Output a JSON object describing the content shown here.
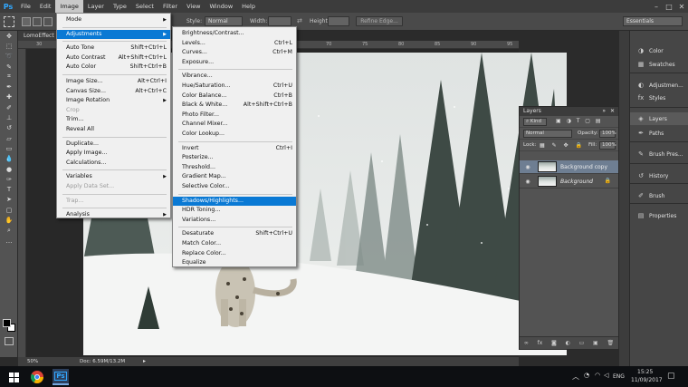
{
  "app": {
    "logo": "Ps"
  },
  "menubar": {
    "items": [
      "File",
      "Edit",
      "Image",
      "Layer",
      "Type",
      "Select",
      "Filter",
      "View",
      "Window",
      "Help"
    ],
    "active_index": 2,
    "window_controls": {
      "minimize": "–",
      "maximize": "□",
      "close": "✕"
    }
  },
  "options_bar": {
    "style_label": "Style:",
    "style_value": "Normal",
    "width_label": "Width:",
    "height_label": "Height:",
    "refine_edge": "Refine Edge...",
    "workspace": "Essentials"
  },
  "document": {
    "tab_label": "LomoEffect",
    "zoom": "50%",
    "doc_info": "Doc: 6.59M/13.2M",
    "ruler_numbers": [
      "30",
      "35",
      "40",
      "45",
      "50",
      "55",
      "60",
      "65",
      "70",
      "75",
      "80",
      "85",
      "90",
      "95"
    ]
  },
  "image_menu": {
    "items": [
      {
        "label": "Mode",
        "shortcut": "",
        "submenu": true,
        "disabled": false
      },
      {
        "sep": true
      },
      {
        "label": "Adjustments",
        "shortcut": "",
        "submenu": true,
        "disabled": false,
        "highlight": true
      },
      {
        "sep": true
      },
      {
        "label": "Auto Tone",
        "shortcut": "Shift+Ctrl+L",
        "disabled": false
      },
      {
        "label": "Auto Contrast",
        "shortcut": "Alt+Shift+Ctrl+L",
        "disabled": false
      },
      {
        "label": "Auto Color",
        "shortcut": "Shift+Ctrl+B",
        "disabled": false
      },
      {
        "sep": true
      },
      {
        "label": "Image Size...",
        "shortcut": "Alt+Ctrl+I",
        "disabled": false
      },
      {
        "label": "Canvas Size...",
        "shortcut": "Alt+Ctrl+C",
        "disabled": false
      },
      {
        "label": "Image Rotation",
        "shortcut": "",
        "submenu": true,
        "disabled": false
      },
      {
        "label": "Crop",
        "shortcut": "",
        "disabled": true
      },
      {
        "label": "Trim...",
        "shortcut": "",
        "disabled": false
      },
      {
        "label": "Reveal All",
        "shortcut": "",
        "disabled": false
      },
      {
        "sep": true
      },
      {
        "label": "Duplicate...",
        "shortcut": "",
        "disabled": false
      },
      {
        "label": "Apply Image...",
        "shortcut": "",
        "disabled": false
      },
      {
        "label": "Calculations...",
        "shortcut": "",
        "disabled": false
      },
      {
        "sep": true
      },
      {
        "label": "Variables",
        "shortcut": "",
        "submenu": true,
        "disabled": false
      },
      {
        "label": "Apply Data Set...",
        "shortcut": "",
        "disabled": true
      },
      {
        "sep": true
      },
      {
        "label": "Trap...",
        "shortcut": "",
        "disabled": true
      },
      {
        "sep": true
      },
      {
        "label": "Analysis",
        "shortcut": "",
        "submenu": true,
        "disabled": false
      }
    ]
  },
  "adjustments_menu": {
    "items": [
      {
        "label": "Brightness/Contrast...",
        "shortcut": ""
      },
      {
        "label": "Levels...",
        "shortcut": "Ctrl+L"
      },
      {
        "label": "Curves...",
        "shortcut": "Ctrl+M"
      },
      {
        "label": "Exposure...",
        "shortcut": ""
      },
      {
        "sep": true
      },
      {
        "label": "Vibrance...",
        "shortcut": ""
      },
      {
        "label": "Hue/Saturation...",
        "shortcut": "Ctrl+U"
      },
      {
        "label": "Color Balance...",
        "shortcut": "Ctrl+B"
      },
      {
        "label": "Black & White...",
        "shortcut": "Alt+Shift+Ctrl+B"
      },
      {
        "label": "Photo Filter...",
        "shortcut": ""
      },
      {
        "label": "Channel Mixer...",
        "shortcut": ""
      },
      {
        "label": "Color Lookup...",
        "shortcut": ""
      },
      {
        "sep": true
      },
      {
        "label": "Invert",
        "shortcut": "Ctrl+I"
      },
      {
        "label": "Posterize...",
        "shortcut": ""
      },
      {
        "label": "Threshold...",
        "shortcut": ""
      },
      {
        "label": "Gradient Map...",
        "shortcut": ""
      },
      {
        "label": "Selective Color...",
        "shortcut": ""
      },
      {
        "sep": true
      },
      {
        "label": "Shadows/Highlights...",
        "shortcut": "",
        "highlight": true
      },
      {
        "label": "HDR Toning...",
        "shortcut": ""
      },
      {
        "label": "Variations...",
        "shortcut": ""
      },
      {
        "sep": true
      },
      {
        "label": "Desaturate",
        "shortcut": "Shift+Ctrl+U"
      },
      {
        "label": "Match Color...",
        "shortcut": ""
      },
      {
        "label": "Replace Color...",
        "shortcut": ""
      },
      {
        "label": "Equalize",
        "shortcut": ""
      }
    ]
  },
  "layers_panel": {
    "title": "Layers",
    "kind_filter": "Kind",
    "blend_mode": "Normal",
    "opacity_label": "Opacity:",
    "opacity_value": "100%",
    "lock_label": "Lock:",
    "fill_label": "Fill:",
    "fill_value": "100%",
    "layers": [
      {
        "name": "Background copy",
        "selected": true,
        "italic": false
      },
      {
        "name": "Background",
        "selected": false,
        "italic": true
      }
    ]
  },
  "dock": {
    "items": [
      {
        "label": "Color",
        "icon": "color-icon"
      },
      {
        "label": "Swatches",
        "icon": "swatches-icon"
      },
      {
        "label": "Adjustmen...",
        "icon": "adjustments-icon"
      },
      {
        "label": "Styles",
        "icon": "styles-icon"
      },
      {
        "label": "Layers",
        "icon": "layers-icon"
      },
      {
        "label": "Paths",
        "icon": "paths-icon"
      },
      {
        "label": "Brush Pres...",
        "icon": "brush-presets-icon"
      },
      {
        "label": "History",
        "icon": "history-icon"
      },
      {
        "label": "Brush",
        "icon": "brush-icon"
      },
      {
        "label": "Properties",
        "icon": "properties-icon"
      }
    ]
  },
  "taskbar": {
    "language": "ENG",
    "time": "15:25",
    "date": "11/09/2017"
  },
  "colors": {
    "menu_highlight": "#0a79d4",
    "ps_blue": "#31a8ff",
    "selected_layer": "#6e7e92"
  }
}
